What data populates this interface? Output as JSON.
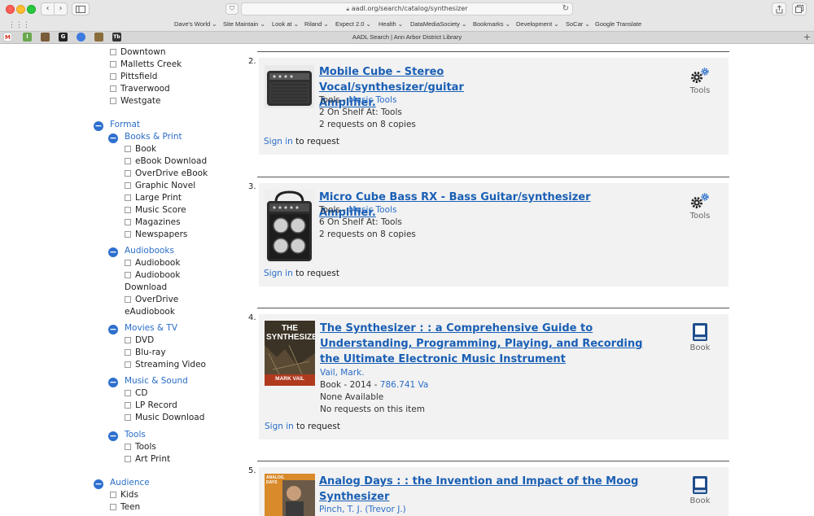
{
  "browser": {
    "url": "aadl.org/search/catalog/synthesizer",
    "tab_title": "AADL Search | Ann Arbor District Library",
    "bookmarks": [
      "Dave's World ⌄",
      "Site Maintain ⌄",
      "Look at ⌄",
      "Riland ⌄",
      "Expect 2.0 ⌄",
      "Health ⌄",
      "DataMediaSociety ⌄",
      "Bookmarks ⌄",
      "Development ⌄",
      "SoCar ⌄",
      "Google Translate"
    ]
  },
  "sidebar": {
    "top_options": [
      "Downtown",
      "Malletts Creek",
      "Pittsfield",
      "Traverwood",
      "Westgate"
    ],
    "format": {
      "label": "Format",
      "books": {
        "label": "Books & Print",
        "options": [
          "Book",
          "eBook Download",
          "OverDrive eBook",
          "Graphic Novel",
          "Large Print",
          "Music Score",
          "Magazines",
          "Newspapers"
        ]
      },
      "audiobooks": {
        "label": "Audiobooks",
        "options": [
          "Audiobook",
          "Audiobook",
          "Download",
          "OverDrive",
          "eAudiobook"
        ]
      },
      "movies": {
        "label": "Movies & TV",
        "options": [
          "DVD",
          "Blu-ray",
          "Streaming Video"
        ]
      },
      "music": {
        "label": "Music & Sound",
        "options": [
          "CD",
          "LP Record",
          "Music Download"
        ]
      },
      "tools": {
        "label": "Tools",
        "options": [
          "Tools",
          "Art Print"
        ]
      }
    },
    "audience": {
      "label": "Audience",
      "options": [
        "Kids",
        "Teen"
      ]
    }
  },
  "results": [
    {
      "number": "2.",
      "title_lines": [
        "Mobile Cube - Stereo Vocal/synthesizer/guitar",
        "Amplifier."
      ],
      "line1_prefix": "Tools - ",
      "line1_link": "Music Tools",
      "line2": "2 On Shelf At: Tools",
      "line3": "2 requests on 8 copies",
      "sign_in": "Sign in",
      "sign_suffix": "to request",
      "type": "Tools"
    },
    {
      "number": "3.",
      "title_lines": [
        "Micro Cube Bass RX - Bass Guitar/synthesizer Amplifier."
      ],
      "line1_prefix": "Tools - ",
      "line1_link": "Music Tools",
      "line2": "6 On Shelf At: Tools",
      "line3": "2 requests on 8 copies",
      "sign_in": "Sign in",
      "sign_suffix": "to request",
      "type": "Tools"
    },
    {
      "number": "4.",
      "title_lines": [
        "The Synthesizer : : a Comprehensive Guide to",
        "Understanding, Programming, Playing, and Recording",
        "the Ultimate Electronic Music Instrument"
      ],
      "author": "Vail, Mark.",
      "line1_prefix": "Book - 2014 - ",
      "line1_link": "786.741 Va",
      "line2": "None Available",
      "line3": "No requests on this item",
      "sign_in": "Sign in",
      "sign_suffix": "to request",
      "type": "Book",
      "cover_title": "THE SYNTHESIZER",
      "cover_author": "MARK VAIL"
    },
    {
      "number": "5.",
      "title_lines": [
        "Analog Days : : the Invention and Impact of the Moog",
        "Synthesizer"
      ],
      "author": "Pinch, T. J. (Trevor J.)",
      "type": "Book",
      "cover_title": "ANALOG DAYS"
    }
  ],
  "colors": {
    "link": "#1a5fb4",
    "facet": "#2a6dc7",
    "minus_badge": "#2e6fcf",
    "card_bg": "#f2f2f2"
  }
}
